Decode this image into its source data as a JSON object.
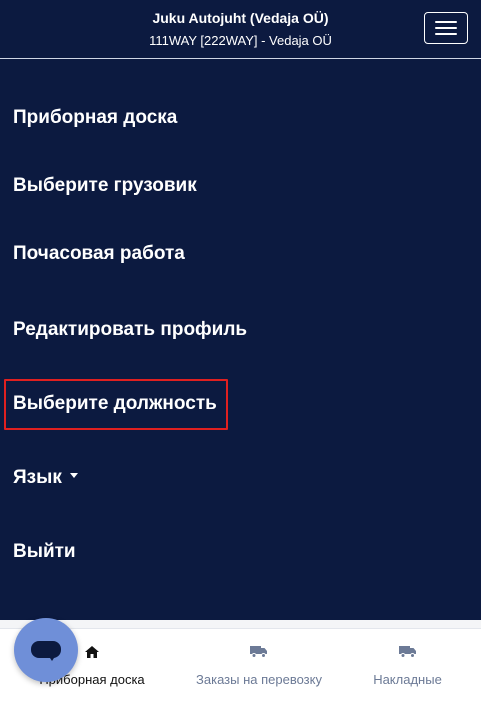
{
  "header": {
    "title": "Juku Autojuht (Vedaja OÜ)",
    "subtitle": "111WAY [222WAY] - Vedaja OÜ"
  },
  "menu": {
    "items": [
      {
        "label": "Приборная доска"
      },
      {
        "label": "Выберите грузовик"
      },
      {
        "label": "Почасовая работа"
      },
      {
        "label": "Редактировать профиль"
      },
      {
        "label": "Выберите должность",
        "highlighted": true
      },
      {
        "label": "Язык",
        "has_dropdown": true
      },
      {
        "label": "Выйти"
      }
    ]
  },
  "bottom_nav": {
    "tabs": [
      {
        "label": "Приборная доска",
        "icon": "home-icon",
        "active": true
      },
      {
        "label": "Заказы на перевозку",
        "icon": "truck-icon",
        "active": false
      },
      {
        "label": "Накладные",
        "icon": "truck-icon",
        "active": false
      }
    ]
  },
  "colors": {
    "background": "#0c1a40",
    "highlight": "#e02020",
    "chat_bubble": "#6f8fd8",
    "inactive_tab": "#6c7a96"
  }
}
